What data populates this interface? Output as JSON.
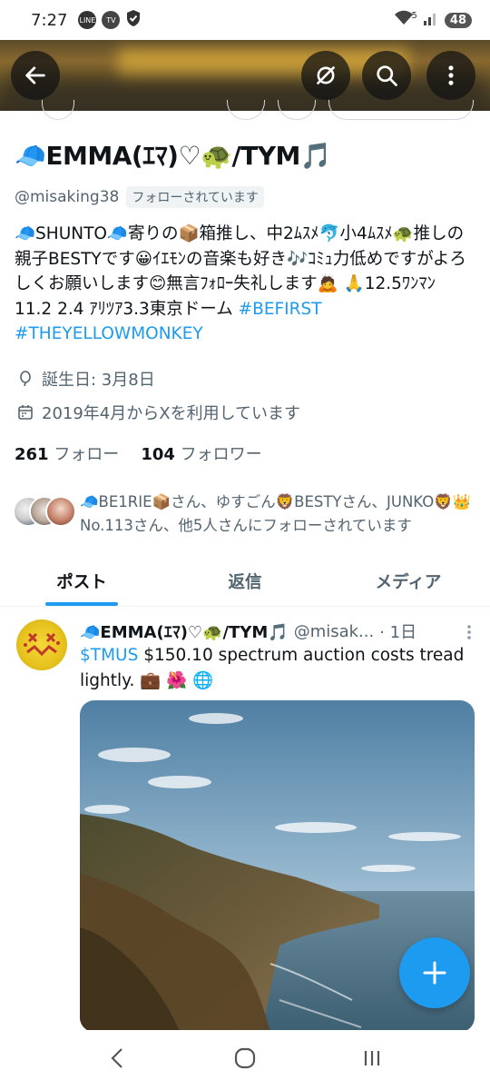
{
  "status_bar": {
    "time": "7:27",
    "icons": [
      "line-icon",
      "tver-icon",
      "shield-check-icon"
    ],
    "wifi_label": "5",
    "battery": "48"
  },
  "top_bar": {
    "back_icon": "arrow-left-icon",
    "hide_icon": "eye-slash-icon",
    "search_icon": "search-icon",
    "more_icon": "more-vertical-icon"
  },
  "profile": {
    "display_name": "🧢EMMA(ｴﾏ)♡🐢/TYM🎵",
    "handle": "@misaking38",
    "follows_you": "フォローされています",
    "bio_text": "🧢SHUNTO🧢寄りの📦箱推し、中2ﾑｽﾒ🐬小4ﾑｽﾒ🐢推しの親子BESTYです😀ｲｴﾓﾝの音楽も好き🎶ｺﾐｭ力低めですがよろしくお願いします😊無言ﾌｫﾛｰ失礼します🙇 🙏12.5ﾜﾝﾏﾝ 11.2 2.4 ｱﾘﾂｱ3.3東京ドーム ",
    "bio_hashtag_1": "#BEFIRST",
    "bio_hashtag_2": "#THEYELLOWMONKEY",
    "birthday": "誕生日: 3月8日",
    "joined": "2019年4月からXを利用しています",
    "following_count": "261",
    "following_label": "フォロー",
    "followers_count": "104",
    "followers_label": "フォロワー",
    "followed_by": "🧢BE1RIE📦さん、ゆすごん🦁BESTYさん、JUNKO🦁👑No.113さん、他5人さんにフォローされています"
  },
  "tabs": [
    {
      "label": "ポスト",
      "active": true
    },
    {
      "label": "返信",
      "active": false
    },
    {
      "label": "メディア",
      "active": false
    }
  ],
  "post": {
    "author_name": "🧢EMMA(ｴﾏ)♡🐢/TYM🎵",
    "author_handle": "@misak...",
    "time": "· 1日",
    "cashtag": "$TMUS",
    "text": " $150.10 spectrum auction costs tread lightly. 💼 🌺 🌐"
  },
  "colors": {
    "accent": "#1d9bf0",
    "secondary_text": "#536471",
    "primary_text": "#0f1419"
  }
}
